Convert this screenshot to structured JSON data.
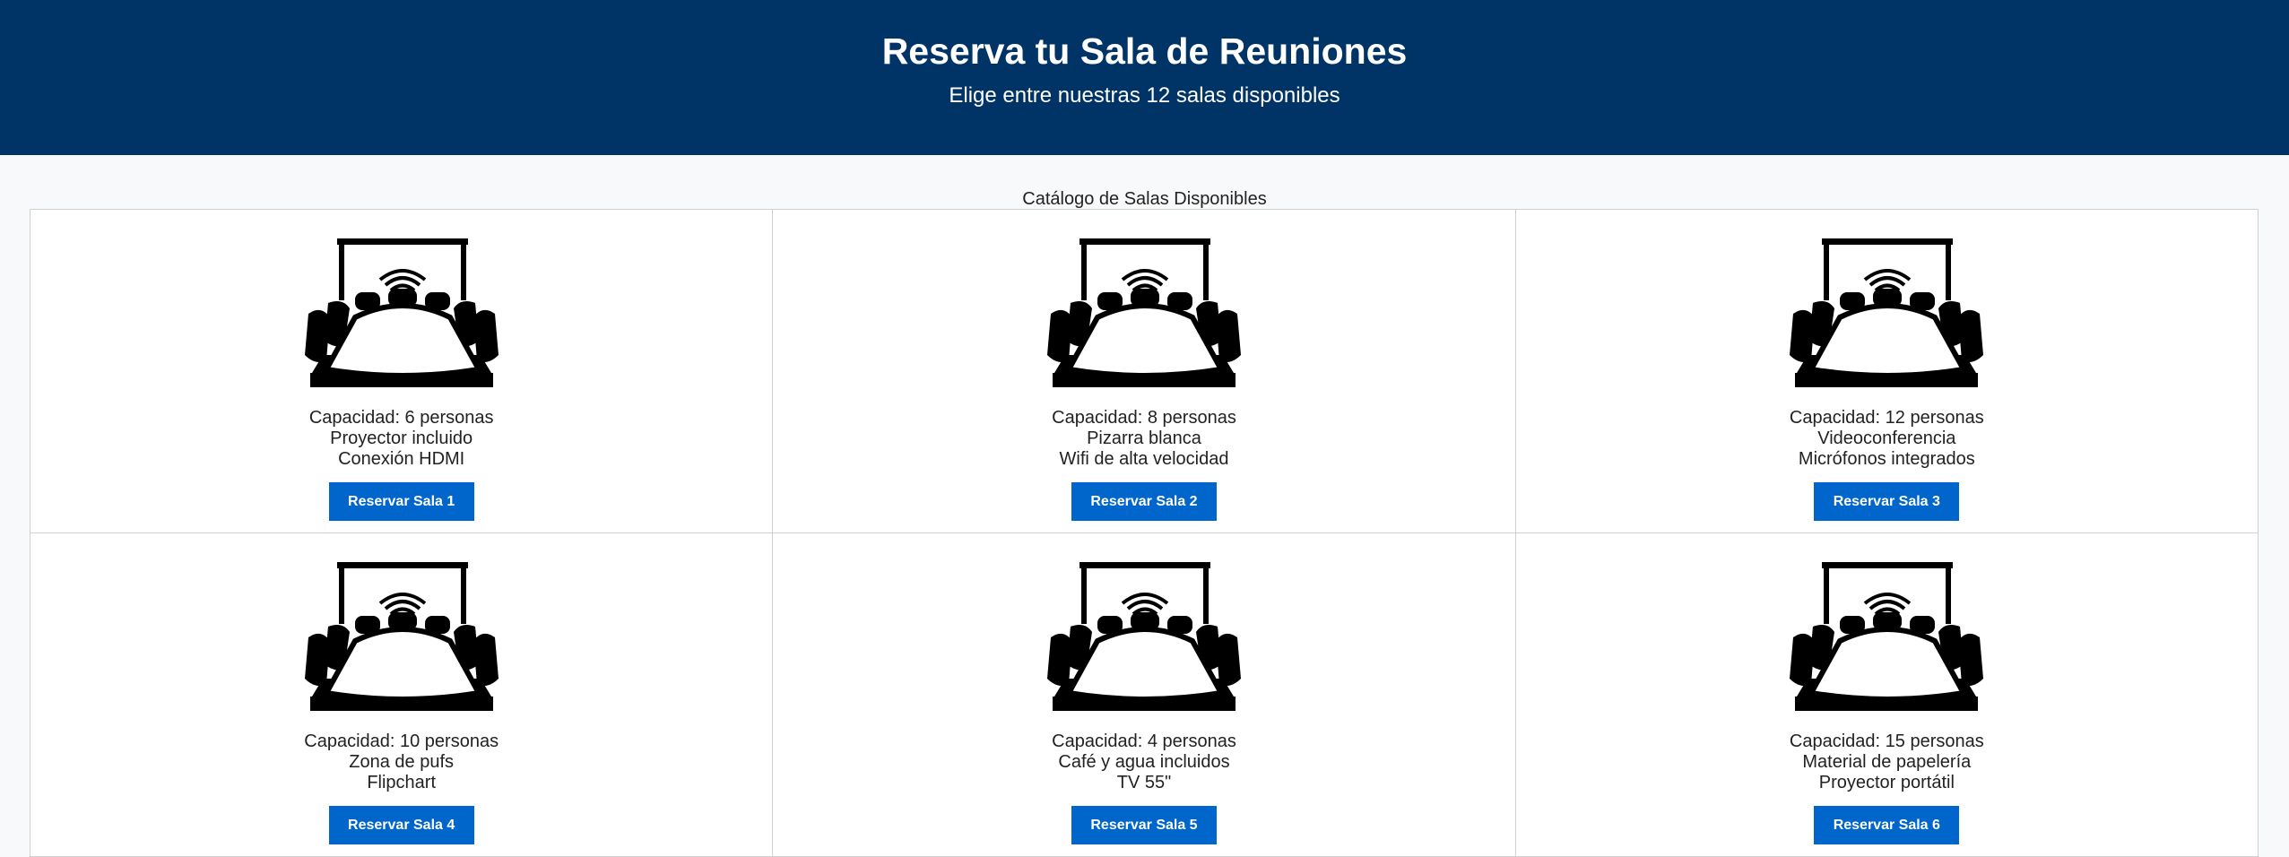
{
  "header": {
    "title": "Reserva tu Sala de Reuniones",
    "subtitle": "Elige entre nuestras 12 salas disponibles"
  },
  "catalog": {
    "title": "Catálogo de Salas Disponibles"
  },
  "rooms": [
    {
      "icon": "meeting-room-icon",
      "capacity": "Capacidad: 6 personas",
      "feature1": "Proyector incluido",
      "feature2": "Conexión HDMI",
      "button": "Reservar Sala 1"
    },
    {
      "icon": "meeting-room-icon",
      "capacity": "Capacidad: 8 personas",
      "feature1": "Pizarra blanca",
      "feature2": "Wifi de alta velocidad",
      "button": "Reservar Sala 2"
    },
    {
      "icon": "meeting-room-icon",
      "capacity": "Capacidad: 12 personas",
      "feature1": "Videoconferencia",
      "feature2": "Micrófonos integrados",
      "button": "Reservar Sala 3"
    },
    {
      "icon": "meeting-room-icon",
      "capacity": "Capacidad: 10 personas",
      "feature1": "Zona de pufs",
      "feature2": "Flipchart",
      "button": "Reservar Sala 4"
    },
    {
      "icon": "meeting-room-icon",
      "capacity": "Capacidad: 4 personas",
      "feature1": "Café y agua incluidos",
      "feature2": "TV 55\"",
      "button": "Reservar Sala 5"
    },
    {
      "icon": "meeting-room-icon",
      "capacity": "Capacidad: 15 personas",
      "feature1": "Material de papelería",
      "feature2": "Proyector portátil",
      "button": "Reservar Sala 6"
    }
  ],
  "colors": {
    "header_bg": "#003366",
    "button_bg": "#0066cc",
    "page_bg": "#f8f9fa"
  }
}
